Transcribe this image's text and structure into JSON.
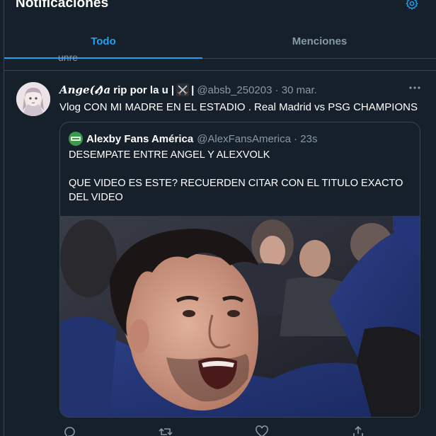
{
  "header": {
    "title": "Notificaciones",
    "settings_icon": "gear-icon"
  },
  "tabs": [
    {
      "label": "Todo",
      "active": true
    },
    {
      "label": "Menciones",
      "active": false
    }
  ],
  "previous_snippet": "unre",
  "tweet": {
    "name_prefix": "𝑨𝒏𝒈𝒆(𝓵)𝒂",
    "name_suffix": "rip por la u |",
    "name_end": "|",
    "handle_line": "@absb_250203 · 30 mar.",
    "text": "Vlog CON MI MADRE EN EL ESTADIO . Real Madrid vs PSG CHAMPIONS",
    "quote": {
      "name": "Alexby Fans América",
      "handle_line": "@AlexFansAmerica · 23s",
      "line1": "DESEMPATE ENTRE ANGEL Y ALEXVOLK",
      "line2": "QUE VIDEO ES ESTE? RECUERDEN CITAR CON EL TITULO EXACTO DEL VIDEO"
    }
  },
  "colors": {
    "background": "#15202b",
    "accent": "#1da1f2",
    "muted": "#8899a6",
    "border": "#38444d"
  }
}
